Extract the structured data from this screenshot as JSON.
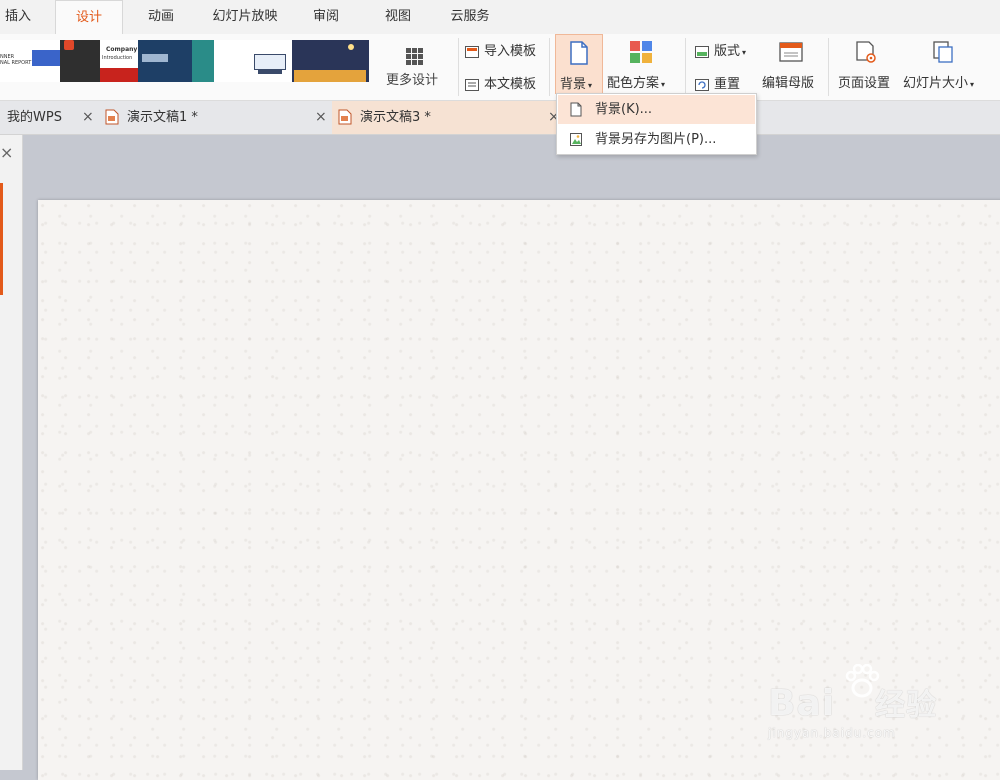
{
  "menu": {
    "tabs": [
      {
        "label": "插入"
      },
      {
        "label": "设计",
        "active": true
      },
      {
        "label": "动画"
      },
      {
        "label": "幻灯片放映"
      },
      {
        "label": "审阅"
      },
      {
        "label": "视图"
      },
      {
        "label": "云服务"
      }
    ]
  },
  "ribbon": {
    "thumb1": {
      "l1": "NNER",
      "l2": "NAL REPORT"
    },
    "thumb3": {
      "title": "Company",
      "subtitle": "Introduction"
    },
    "more_design": "更多设计",
    "import_template": "导入模板",
    "this_template": "本文模板",
    "background": "背景",
    "color_scheme": "配色方案",
    "layout": "版式",
    "reset": "重置",
    "edit_master": "编辑母版",
    "page_setup": "页面设置",
    "slide_size": "幻灯片大小",
    "caret": "▾"
  },
  "doctabs": {
    "items": [
      {
        "label": "我的WPS"
      },
      {
        "label": "演示文稿1 *"
      },
      {
        "label": "演示文稿3 *",
        "active": true
      }
    ],
    "close": "×"
  },
  "leftpanel": {
    "close": "×"
  },
  "dropdown": {
    "items": [
      {
        "label": "背景(K)...",
        "icon": "page-icon",
        "highlighted": true
      },
      {
        "label": "背景另存为图片(P)...",
        "icon": "image-save-icon"
      }
    ]
  },
  "watermark": {
    "brand": "Bai",
    "brand2": "经验",
    "url": "jingyan.baidu.com"
  },
  "colors": {
    "accent": "#e35a1a",
    "highlight": "#fce4d6",
    "workspace": "#c5c8d0"
  }
}
